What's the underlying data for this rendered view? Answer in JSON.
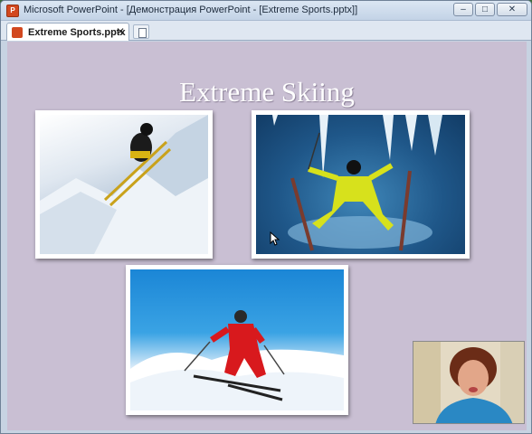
{
  "window": {
    "title": "Microsoft PowerPoint - [Демонстрация PowerPoint - [Extreme Sports.pptx]]",
    "app_icon": "powerpoint-icon",
    "controls": {
      "minimize": "–",
      "restore": "□",
      "close": "✕"
    }
  },
  "tabs": [
    {
      "label": "Extreme Sports.pptx",
      "close": "✕",
      "icon": "powerpoint-doc-icon"
    }
  ],
  "slide": {
    "title": "Extreme Skiing",
    "background_color": "#c9bfd3",
    "photos": [
      {
        "name": "skier-jumping-photo"
      },
      {
        "name": "skier-yellow-suit-photo"
      },
      {
        "name": "skier-red-suit-photo"
      }
    ]
  },
  "overlay": {
    "webcam": "presenter-webcam"
  }
}
